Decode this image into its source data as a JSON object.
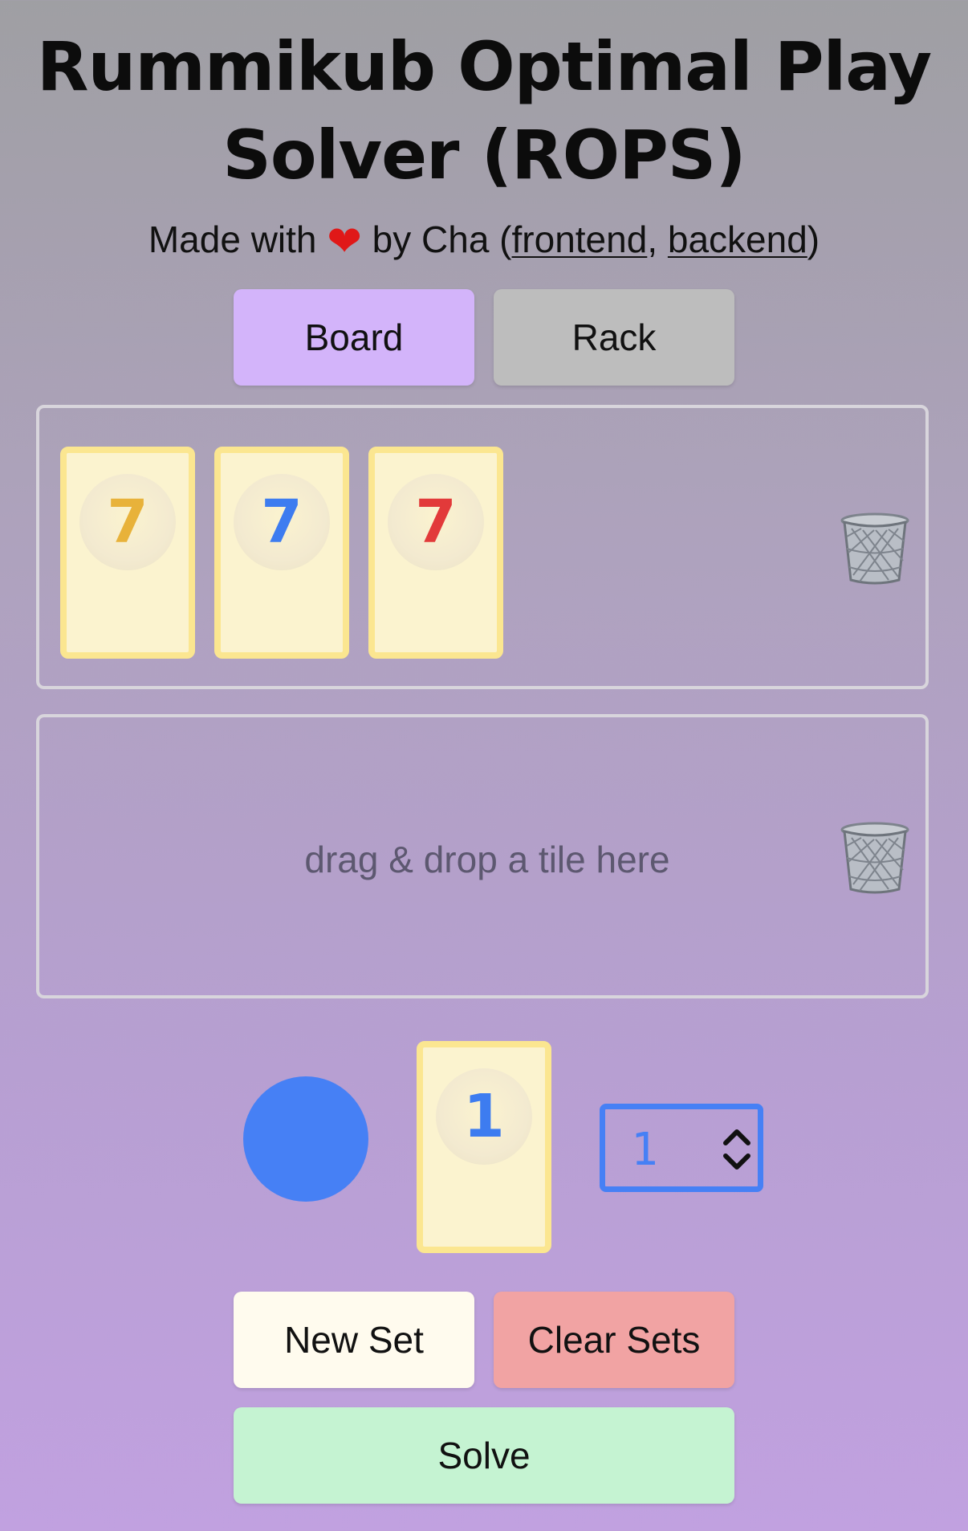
{
  "header": {
    "title_line1": "Rummikub Optimal Play",
    "title_line2": "Solver (ROPS)",
    "subtitle_prefix": "Made with",
    "subtitle_heart": "❤",
    "subtitle_by": "by Cha (",
    "link_frontend": "frontend",
    "subtitle_comma": ",",
    "link_backend": "backend",
    "subtitle_suffix": ")"
  },
  "tabs": [
    {
      "label": "Board",
      "active": true,
      "color": "#d3b4fa"
    },
    {
      "label": "Rack",
      "active": false,
      "color": "#bdbdbd"
    }
  ],
  "sets": [
    {
      "tiles": [
        {
          "number": "7",
          "color": "#e8b23a"
        },
        {
          "number": "7",
          "color": "#3d7cf0"
        },
        {
          "number": "7",
          "color": "#e23a3a"
        }
      ]
    },
    {
      "tiles": [],
      "placeholder": "drag & drop a tile here"
    }
  ],
  "tile_builder": {
    "selected_color": "#4680f5",
    "preview_number": "1",
    "number_value": "1"
  },
  "actions": {
    "new_set": "New Set",
    "clear_sets": "Clear Sets",
    "solve": "Solve"
  },
  "icons": {
    "trash": "trash-icon",
    "spinner": "spinner-arrows-icon"
  }
}
